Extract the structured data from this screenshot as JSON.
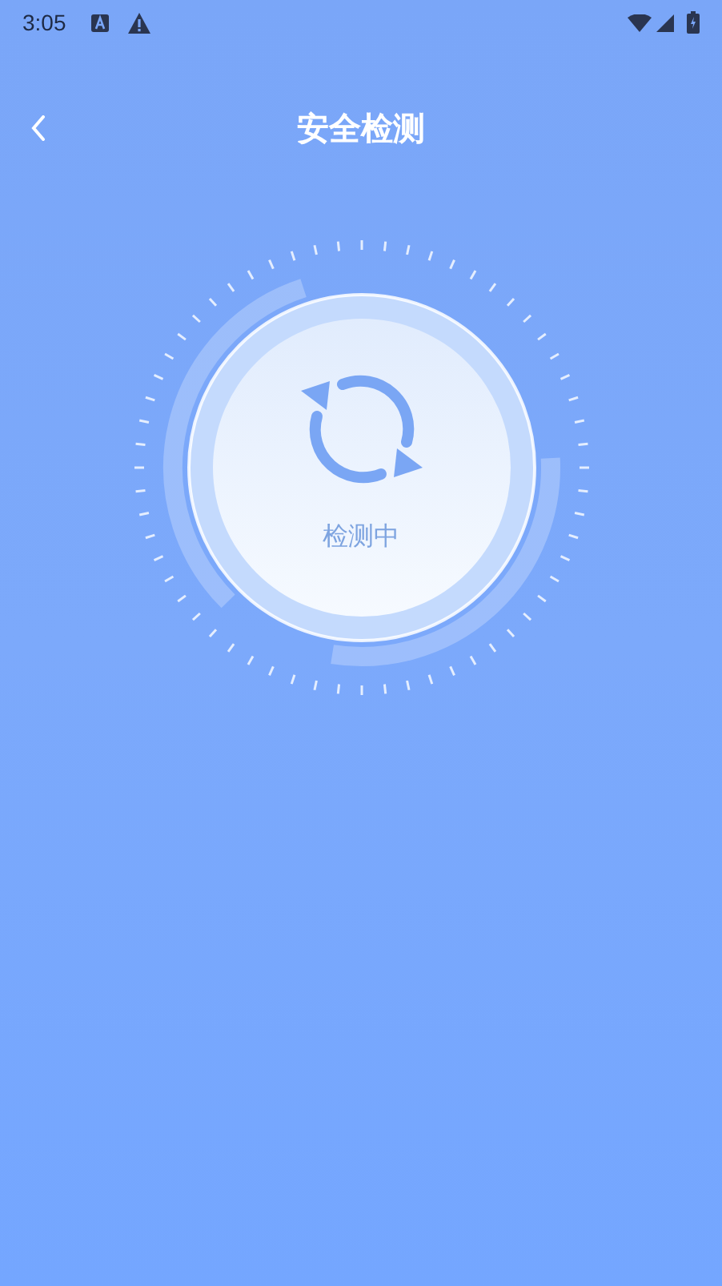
{
  "status_bar": {
    "time": "3:05"
  },
  "header": {
    "title": "安全检测"
  },
  "scan": {
    "status": "检测中"
  }
}
